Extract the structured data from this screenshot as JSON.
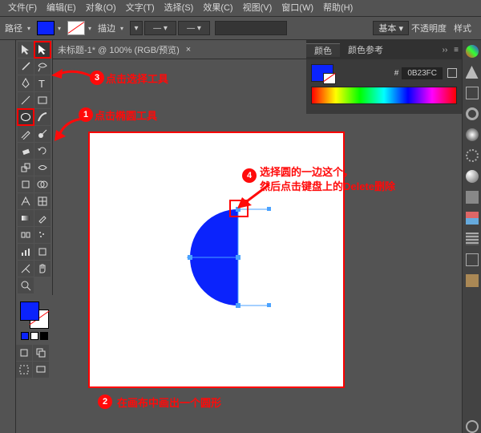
{
  "menu": [
    "文件(F)",
    "编辑(E)",
    "对象(O)",
    "文字(T)",
    "选择(S)",
    "效果(C)",
    "视图(V)",
    "窗口(W)",
    "帮助(H)"
  ],
  "optbar": {
    "path_label": "路径",
    "stroke_label": "描边",
    "lib_basic": "基本",
    "opacity": "不透明度",
    "style": "样式"
  },
  "doc": {
    "title": "未标题-1* @ 100% (RGB/预览)"
  },
  "panel": {
    "tab_color": "颜色",
    "tab_guide": "颜色参考",
    "hash": "#",
    "hex": "0B23FC"
  },
  "tut": {
    "b1_text": "点击椭圆工具",
    "b2_text": "在画布中画出一个圆形",
    "b3_text": "点击选择工具",
    "b4_line1": "选择圆的一边这个，",
    "b4_line2": "然后点击键盘上的Delete删除"
  },
  "badge_labels": {
    "1": "1",
    "2": "2",
    "3": "3",
    "4": "4"
  }
}
